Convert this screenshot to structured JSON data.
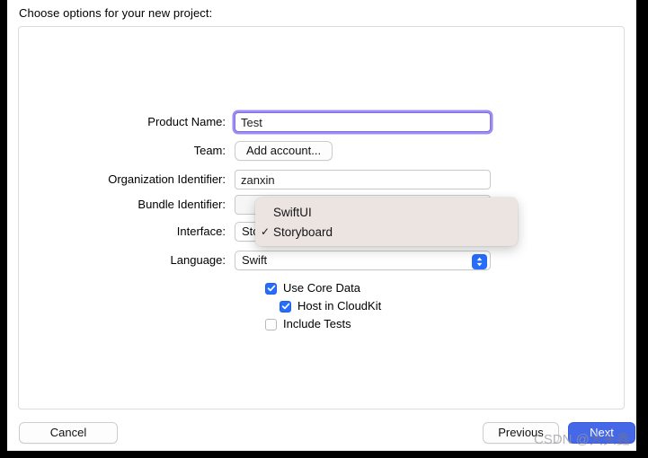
{
  "window": {
    "sheet_title": "Choose options for your new project:"
  },
  "form": {
    "rows": [
      {
        "label": "Product Name:",
        "value": "Test",
        "type": "textfield-focused"
      },
      {
        "label": "Team:",
        "value": "Add account...",
        "type": "button"
      },
      {
        "label": "Organization Identifier:",
        "value": "zanxin",
        "type": "textfield"
      },
      {
        "label": "Bundle Identifier:",
        "value": "",
        "type": "textfield-disabled"
      },
      {
        "label": "Interface:",
        "value": "Storyboard",
        "type": "popup"
      },
      {
        "label": "Language:",
        "value": "Swift",
        "type": "popup"
      }
    ],
    "checkboxes": [
      {
        "label": "Use Core Data",
        "checked": true,
        "indent": 0
      },
      {
        "label": "Host in CloudKit",
        "checked": true,
        "indent": 1
      },
      {
        "label": "Include Tests",
        "checked": false,
        "indent": 0
      }
    ]
  },
  "interface_menu": {
    "open": true,
    "items": [
      {
        "label": "SwiftUI",
        "checked": false
      },
      {
        "label": "Storyboard",
        "checked": true
      }
    ],
    "check_glyph": "✓"
  },
  "bottom_bar": {
    "cancel_label": "Cancel",
    "previous_label": "Previous",
    "next_label": "Next"
  },
  "watermark": {
    "prefix": "CSDN @",
    "handle": "大头鑫"
  },
  "colors": {
    "accent_blue": "#276dfb",
    "primary_button": "#4568e8",
    "focus_ring_purple": "#9d8df0",
    "menu_background": "#ece4e1",
    "panel_border": "#dcdcdc"
  }
}
